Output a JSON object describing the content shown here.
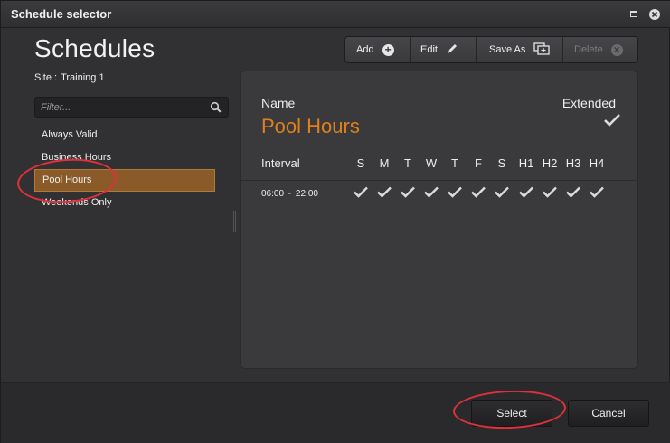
{
  "window": {
    "title": "Schedule selector"
  },
  "heading": "Schedules",
  "site": {
    "label": "Site :",
    "value": "Training 1"
  },
  "toolbar": {
    "add_label": "Add",
    "edit_label": "Edit",
    "saveas_label": "Save As",
    "delete_label": "Delete"
  },
  "filter": {
    "placeholder": "Filter..."
  },
  "schedules": [
    {
      "label": "Always Valid",
      "selected": false
    },
    {
      "label": "Business Hours",
      "selected": false
    },
    {
      "label": "Pool Hours",
      "selected": true
    },
    {
      "label": "Weekends Only",
      "selected": false
    }
  ],
  "detail": {
    "name_label": "Name",
    "extended_label": "Extended",
    "name_value": "Pool Hours",
    "extended": true,
    "interval_label": "Interval",
    "days": [
      "S",
      "M",
      "T",
      "W",
      "T",
      "F",
      "S",
      "H1",
      "H2",
      "H3",
      "H4"
    ],
    "rows": [
      {
        "interval": "06:00  -  22:00",
        "checked": [
          true,
          true,
          true,
          true,
          true,
          true,
          true,
          true,
          true,
          true,
          true
        ]
      }
    ]
  },
  "buttons": {
    "select_label": "Select",
    "cancel_label": "Cancel"
  },
  "colors": {
    "accent": "#e0801c",
    "selection": "#8a5a28",
    "annotation": "#e0303a"
  }
}
